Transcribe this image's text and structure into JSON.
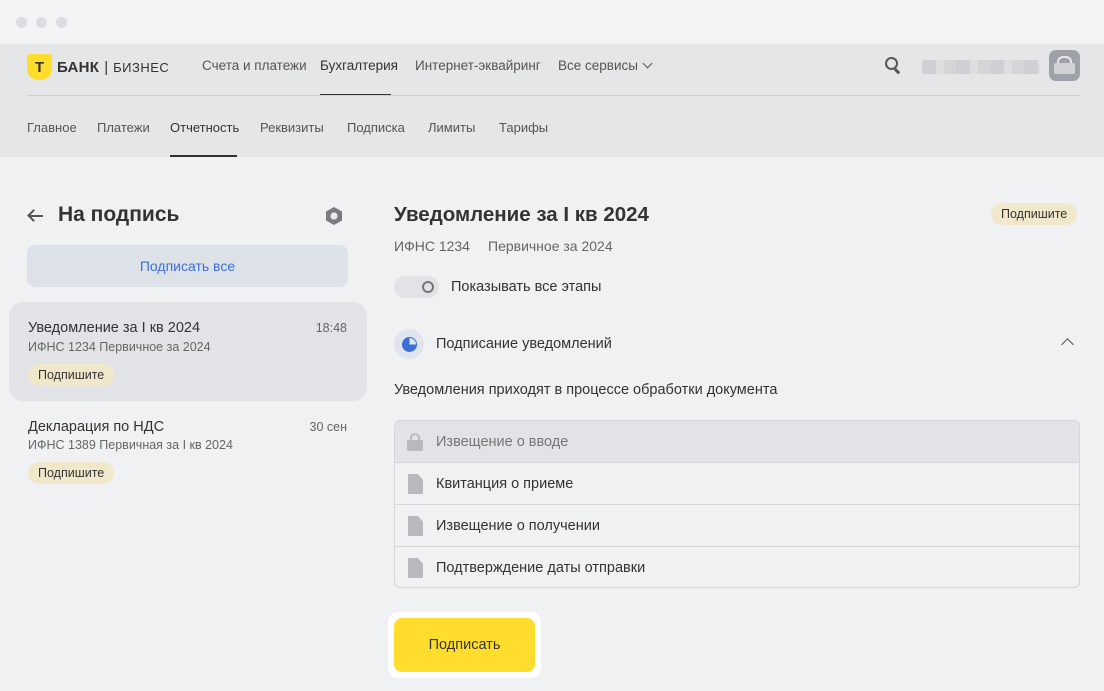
{
  "window": {
    "controls": [
      "close",
      "minimize",
      "maximize"
    ]
  },
  "brand": {
    "logo_letter": "Т",
    "name": "БАНК",
    "separator": "|",
    "product": "БИЗНЕС",
    "logo_color": "#ffdd2d"
  },
  "main_nav": {
    "items": [
      {
        "label": "Счета и платежи"
      },
      {
        "label": "Бухгалтерия",
        "active": true
      },
      {
        "label": "Интернет-эквайринг"
      },
      {
        "label": "Все сервисы",
        "has_dropdown": true
      }
    ]
  },
  "header": {
    "search_icon": "search-icon",
    "user_name_redacted": true,
    "avatar_icon": "avatar"
  },
  "sub_nav": {
    "items": [
      {
        "label": "Главное"
      },
      {
        "label": "Платежи"
      },
      {
        "label": "Отчетность",
        "active": true
      },
      {
        "label": "Реквизиты"
      },
      {
        "label": "Подписка"
      },
      {
        "label": "Лимиты"
      },
      {
        "label": "Тарифы"
      }
    ]
  },
  "left_panel": {
    "title": "На подпись",
    "sign_all_label": "Подписать все",
    "documents": [
      {
        "title": "Уведомление за I кв 2024",
        "time": "18:48",
        "subtitle": "ИФНС 1234  Первичное за 2024",
        "status": "Подпишите",
        "selected": true
      },
      {
        "title": "Декларация по НДС",
        "time": "30 сен",
        "subtitle": "ИФНС 1389  Первичная за I кв 2024",
        "status": "Подпишите",
        "selected": false
      }
    ]
  },
  "detail": {
    "title": "Уведомление за I кв 2024",
    "status": "Подпишите",
    "inspection": "ИФНС 1234",
    "type": "Первичное за 2024",
    "toggle_label": "Показывать все этапы",
    "toggle_on": false,
    "stage_label": "Подписание уведомлений",
    "description": "Уведомления приходят в процессе обработки документа",
    "steps": [
      {
        "label": "Извещение о вводе",
        "icon": "lock-icon",
        "locked": true
      },
      {
        "label": "Квитанция о приеме",
        "icon": "file-icon",
        "locked": false
      },
      {
        "label": "Извещение о получении",
        "icon": "file-icon",
        "locked": false
      },
      {
        "label": "Подтверждение даты отправки",
        "icon": "file-icon",
        "locked": false
      }
    ],
    "sign_label": "Подписать"
  },
  "colors": {
    "accent_blue": "#3b6fd8",
    "sign_yellow": "#ffdd2d",
    "badge_bg": "#f1e8cc"
  }
}
